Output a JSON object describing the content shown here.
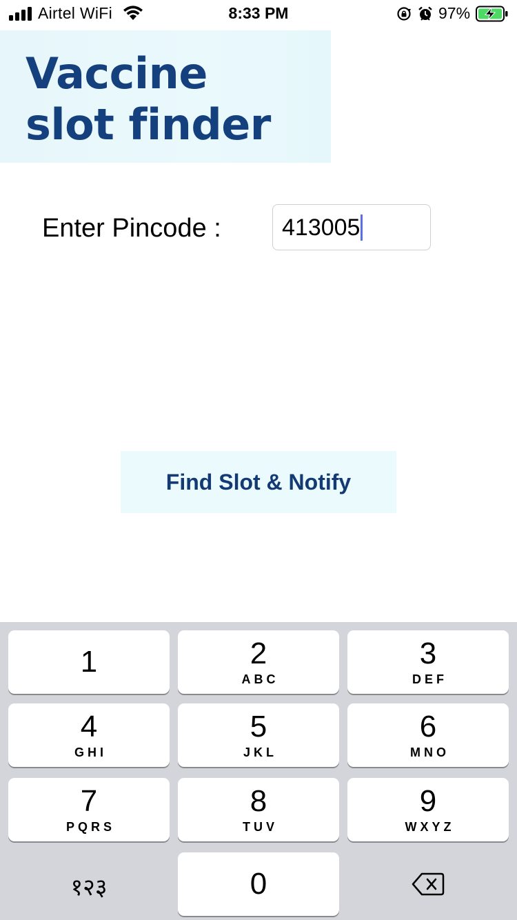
{
  "status_bar": {
    "carrier": "Airtel WiFi",
    "time": "8:33 PM",
    "battery_percent": "97%",
    "icons": [
      "signal-icon",
      "wifi-icon",
      "rotation-lock-icon",
      "alarm-icon",
      "battery-charging-icon"
    ]
  },
  "header": {
    "title_line1": "Vaccine",
    "title_line2": "slot finder",
    "title_color": "#15407e",
    "background": "#e8f8fb"
  },
  "form": {
    "pincode_label": "Enter Pincode :",
    "pincode_value": "413005"
  },
  "actions": {
    "find_button": "Find Slot & Notify"
  },
  "keyboard": {
    "keys": [
      {
        "num": "1",
        "letters": ""
      },
      {
        "num": "2",
        "letters": "ABC"
      },
      {
        "num": "3",
        "letters": "DEF"
      },
      {
        "num": "4",
        "letters": "GHI"
      },
      {
        "num": "5",
        "letters": "JKL"
      },
      {
        "num": "6",
        "letters": "MNO"
      },
      {
        "num": "7",
        "letters": "PQRS"
      },
      {
        "num": "8",
        "letters": "TUV"
      },
      {
        "num": "9",
        "letters": "WXYZ"
      },
      {
        "num": "0",
        "letters": ""
      }
    ],
    "switch_key": "१२३",
    "delete_icon": "backspace-icon"
  }
}
